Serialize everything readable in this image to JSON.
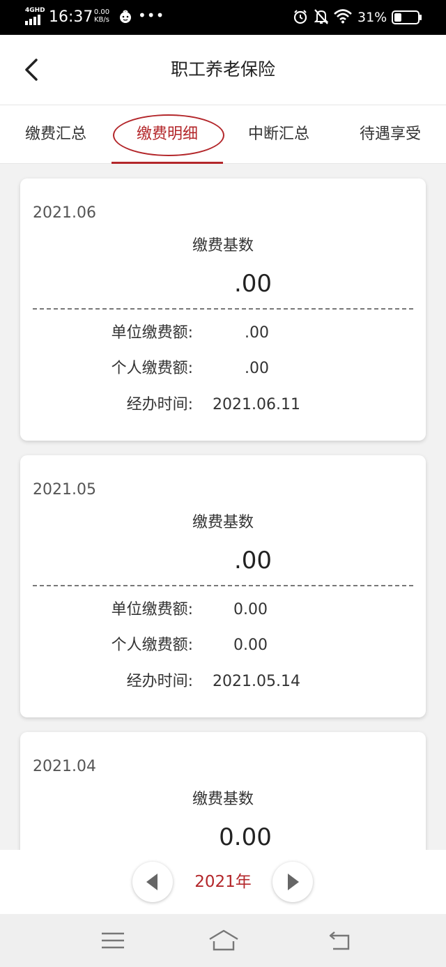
{
  "status_bar": {
    "network": "4GHD",
    "time": "16:37",
    "speed_value": "0.00",
    "speed_unit": "KB/s",
    "more": "•••",
    "battery_percent": "31%",
    "battery_level": 0.31
  },
  "header": {
    "title": "职工养老保险"
  },
  "tabs": [
    {
      "label": "缴费汇总",
      "active": false
    },
    {
      "label": "缴费明细",
      "active": true
    },
    {
      "label": "中断汇总",
      "active": false
    },
    {
      "label": "待遇享受",
      "active": false
    }
  ],
  "records": [
    {
      "period": "2021.06",
      "base_label": "缴费基数",
      "base_value": ".00",
      "unit_label": "单位缴费额:",
      "unit_value": ".00",
      "personal_label": "个人缴费额:",
      "personal_value": ".00",
      "date_label": "经办时间:",
      "date_value": "2021.06.11"
    },
    {
      "period": "2021.05",
      "base_label": "缴费基数",
      "base_value": ".00",
      "unit_label": "单位缴费额:",
      "unit_value": "0.00",
      "personal_label": "个人缴费额:",
      "personal_value": "0.00",
      "date_label": "经办时间:",
      "date_value": "2021.05.14"
    },
    {
      "period": "2021.04",
      "base_label": "缴费基数",
      "base_value": "0.00"
    }
  ],
  "year_switcher": {
    "year": "2021年"
  },
  "colors": {
    "accent": "#b3262a",
    "background": "#f2f2f2"
  }
}
